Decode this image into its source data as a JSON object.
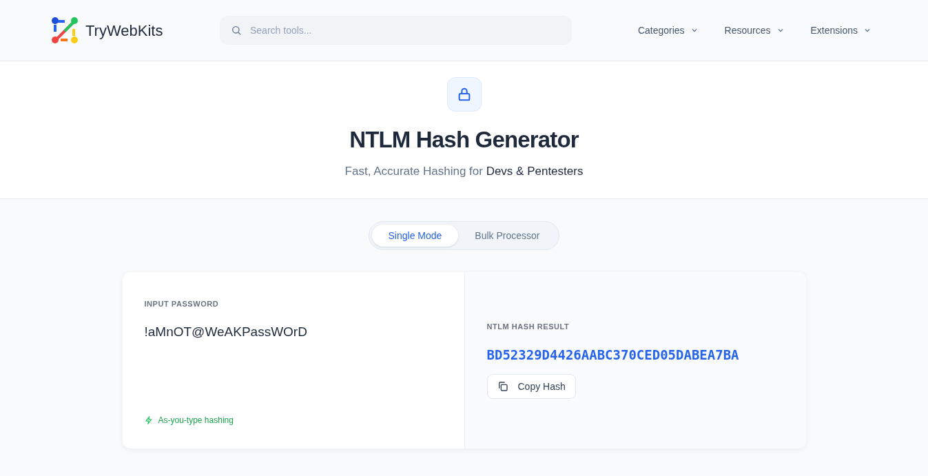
{
  "header": {
    "brand": "TryWebKits",
    "search": {
      "placeholder": "Search tools..."
    },
    "nav": [
      {
        "label": "Categories"
      },
      {
        "label": "Resources"
      },
      {
        "label": "Extensions"
      }
    ]
  },
  "hero": {
    "title": "NTLM Hash Generator",
    "subtitle": "Fast, Accurate Hashing for **Devs & Pentesters**"
  },
  "modes": [
    {
      "label": "Single Mode",
      "selected": true
    },
    {
      "label": "Bulk Processor",
      "selected": false
    }
  ],
  "input": {
    "label": "INPUT PASSWORD",
    "value": "!aMnOT@WeAKPassWOrD",
    "hint": "As-you-type hashing"
  },
  "result": {
    "label": "NTLM HASH RESULT",
    "hash": "BD52329D4426AABC370CED05DABEA7BA",
    "copy_button": "Copy Hash"
  }
}
